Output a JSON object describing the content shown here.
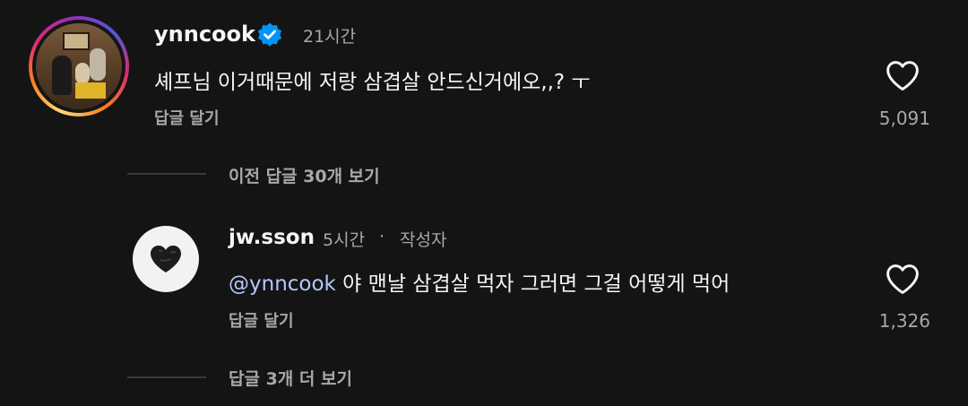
{
  "comments": [
    {
      "username": "ynncook",
      "verified": true,
      "time": "21시간",
      "text": "셰프님 이거때문에 저랑 삼겹살 안드신거에오,,? ㅜ",
      "reply_label": "답글 달기",
      "likes": "5,091"
    },
    {
      "username": "jw.sson",
      "time": "5시간",
      "separator": "·",
      "author_badge": "작성자",
      "mention": "@ynncook",
      "text": " 야 맨날 삼겹살 먹자 그러면 그걸 어떻게 먹어",
      "reply_label": "답글 달기",
      "likes": "1,326"
    }
  ],
  "view_previous_replies": "이전 답글 30개 보기",
  "view_more_replies": "답글 3개 더 보기",
  "icons": {
    "verified": "verified-badge-icon",
    "like": "heart-outline-icon"
  },
  "colors": {
    "background": "#141414",
    "verified_blue": "#0095f6",
    "mention": "#b3c7ff",
    "secondary_text": "#a8a8a8"
  }
}
